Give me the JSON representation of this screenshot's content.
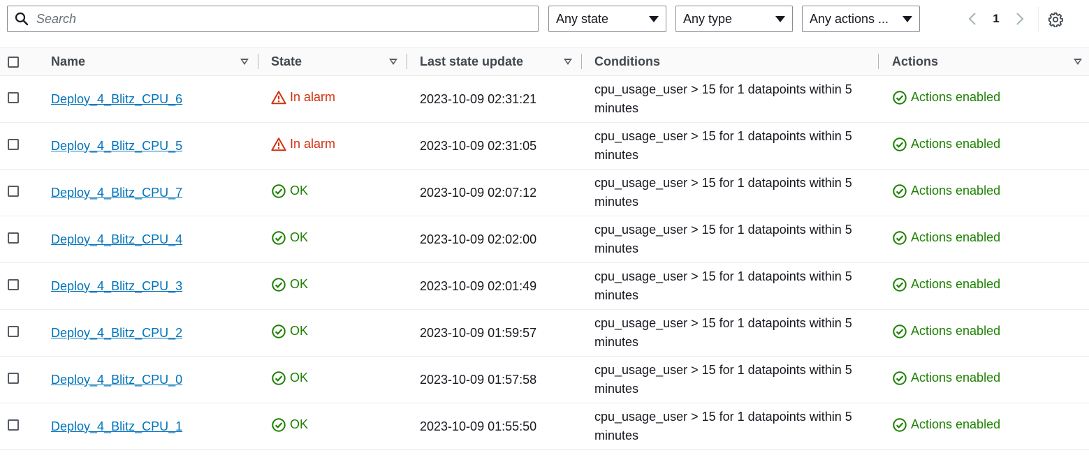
{
  "toolbar": {
    "search_placeholder": "Search",
    "state_filter": "Any state",
    "type_filter": "Any type",
    "actions_filter": "Any actions ...",
    "page_number": "1"
  },
  "table": {
    "columns": {
      "name": "Name",
      "state": "State",
      "last_update": "Last state update",
      "conditions": "Conditions",
      "actions": "Actions"
    },
    "rows": [
      {
        "name": "Deploy_4_Blitz_CPU_6",
        "state": "In alarm",
        "state_kind": "alarm",
        "updated": "2023-10-09 02:31:21",
        "condition": "cpu_usage_user > 15 for 1 datapoints within 5 minutes",
        "actions": "Actions enabled"
      },
      {
        "name": "Deploy_4_Blitz_CPU_5",
        "state": "In alarm",
        "state_kind": "alarm",
        "updated": "2023-10-09 02:31:05",
        "condition": "cpu_usage_user > 15 for 1 datapoints within 5 minutes",
        "actions": "Actions enabled"
      },
      {
        "name": "Deploy_4_Blitz_CPU_7",
        "state": "OK",
        "state_kind": "ok",
        "updated": "2023-10-09 02:07:12",
        "condition": "cpu_usage_user > 15 for 1 datapoints within 5 minutes",
        "actions": "Actions enabled"
      },
      {
        "name": "Deploy_4_Blitz_CPU_4",
        "state": "OK",
        "state_kind": "ok",
        "updated": "2023-10-09 02:02:00",
        "condition": "cpu_usage_user > 15 for 1 datapoints within 5 minutes",
        "actions": "Actions enabled"
      },
      {
        "name": "Deploy_4_Blitz_CPU_3",
        "state": "OK",
        "state_kind": "ok",
        "updated": "2023-10-09 02:01:49",
        "condition": "cpu_usage_user > 15 for 1 datapoints within 5 minutes",
        "actions": "Actions enabled"
      },
      {
        "name": "Deploy_4_Blitz_CPU_2",
        "state": "OK",
        "state_kind": "ok",
        "updated": "2023-10-09 01:59:57",
        "condition": "cpu_usage_user > 15 for 1 datapoints within 5 minutes",
        "actions": "Actions enabled"
      },
      {
        "name": "Deploy_4_Blitz_CPU_0",
        "state": "OK",
        "state_kind": "ok",
        "updated": "2023-10-09 01:57:58",
        "condition": "cpu_usage_user > 15 for 1 datapoints within 5 minutes",
        "actions": "Actions enabled"
      },
      {
        "name": "Deploy_4_Blitz_CPU_1",
        "state": "OK",
        "state_kind": "ok",
        "updated": "2023-10-09 01:55:50",
        "condition": "cpu_usage_user > 15 for 1 datapoints within 5 minutes",
        "actions": "Actions enabled"
      }
    ]
  },
  "colors": {
    "link": "#0073bb",
    "alarm": "#d13212",
    "ok": "#1d8102"
  },
  "icons": {
    "search": "search-icon",
    "alarm": "warning-triangle-icon",
    "ok": "check-circle-icon",
    "settings": "gear-icon"
  }
}
